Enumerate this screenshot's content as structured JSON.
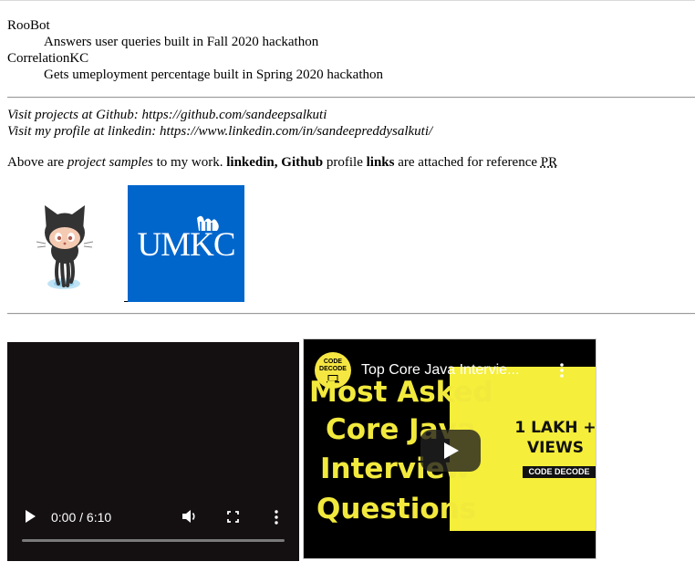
{
  "projects": [
    {
      "name": "RooBot",
      "description": "Answers user queries built in Fall 2020 hackathon"
    },
    {
      "name": "CorrelationKC",
      "description": "Gets umeployment percentage built in Spring 2020 hackathon"
    }
  ],
  "links": {
    "github_line": "Visit projects at Github: https://github.com/sandeepsalkuti",
    "linkedin_line": "Visit my profile at linkedin: https://www.linkedin.com/in/sandeepreddysalkuti/"
  },
  "reference": {
    "p1": "Above are ",
    "p2": "project samples",
    "p3": " to my work. ",
    "p4": "linkedin, Github",
    "p5": " profile ",
    "p6": "links",
    "p7": " are attached for reference ",
    "p8": "PR"
  },
  "logos": {
    "umkc_text": "UMKC"
  },
  "video_player": {
    "time": "0:00 / 6:10",
    "progress": 0
  },
  "youtube": {
    "title": "Top Core Java Intervie...",
    "channel_badge_line1": "CODE",
    "channel_badge_line2": "DECODE",
    "thumb_line1": "Most Asked",
    "thumb_line2": "Core Java",
    "thumb_line3": "Interview",
    "thumb_line4": "Questions",
    "views_line1": "1 LAKH +",
    "views_line2": "VIEWS",
    "tag": "CODE DECODE"
  },
  "colors": {
    "umkc_blue": "#0066cc",
    "thumb_yellow": "#f5ee3a",
    "thumb_text_yellow": "#f2e93d"
  }
}
